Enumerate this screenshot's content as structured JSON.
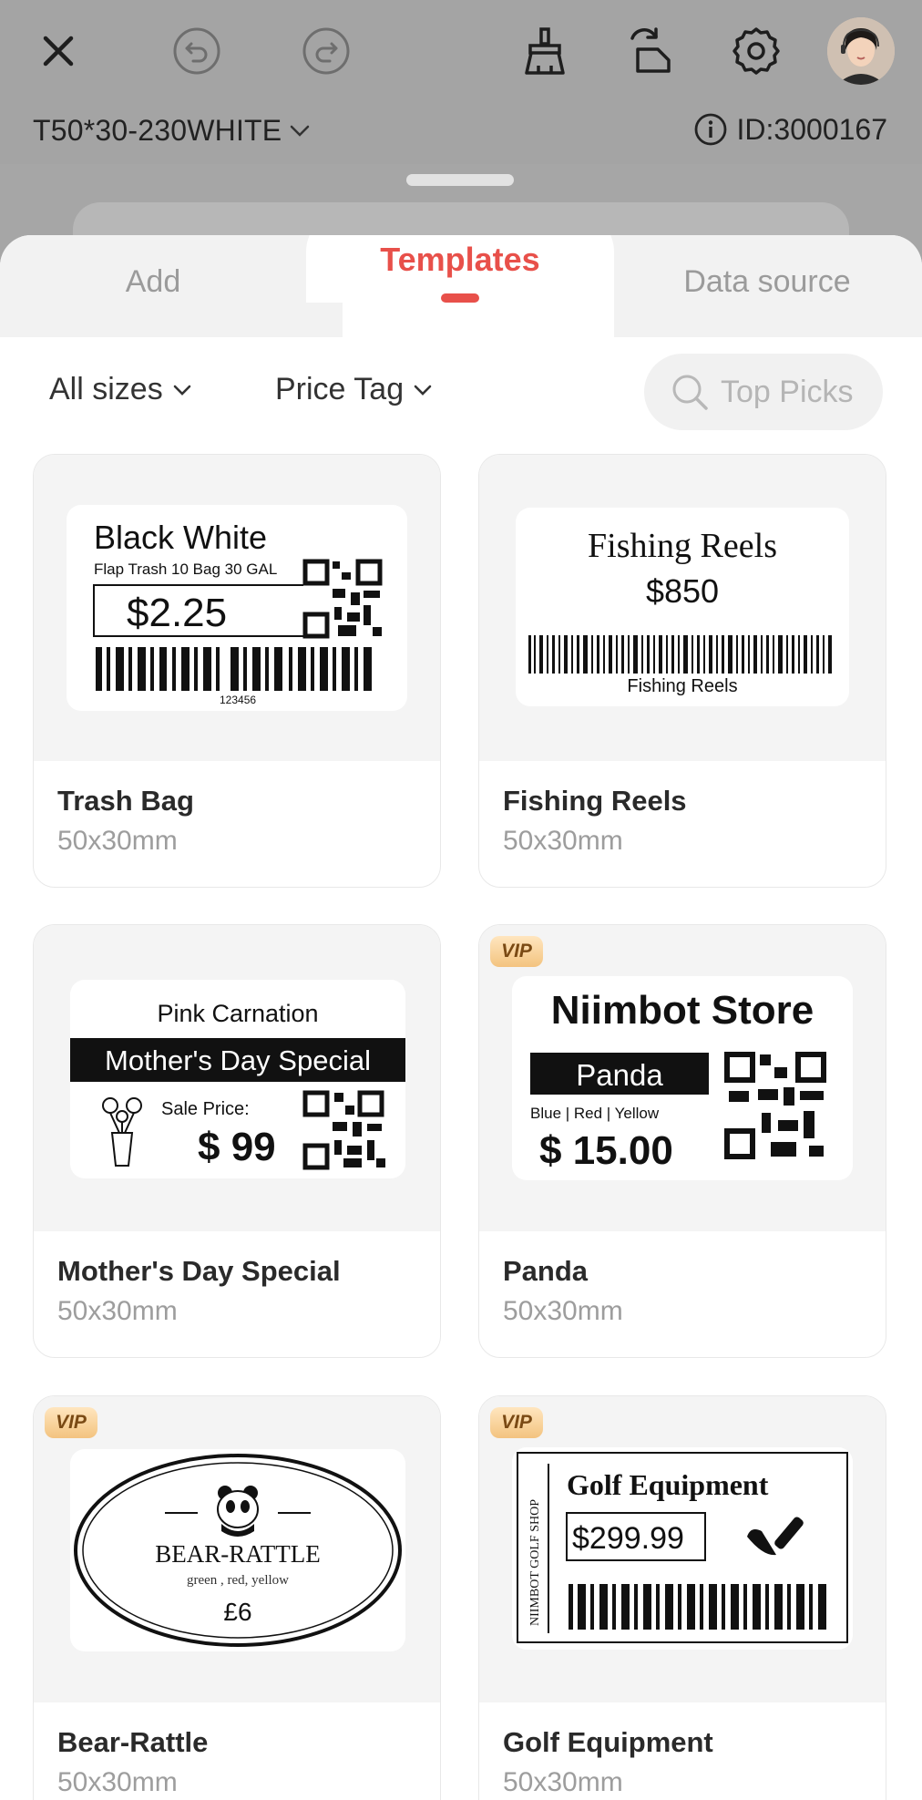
{
  "toolbar": {
    "close_icon": "close-icon",
    "undo_icon": "undo-icon",
    "redo_icon": "redo-icon",
    "clear_icon": "brush-icon",
    "rotate_icon": "rotate-icon",
    "settings_icon": "gear-icon"
  },
  "printer": {
    "label_name": "T50*30-230WHITE",
    "id_text": "ID:3000167"
  },
  "tabs": [
    {
      "label": "Add"
    },
    {
      "label": "Templates",
      "active": true
    },
    {
      "label": "Data source"
    }
  ],
  "filters": {
    "sizes": "All sizes",
    "category": "Price Tag",
    "search_placeholder": "Top Picks"
  },
  "templates": [
    {
      "name": "Trash Bag",
      "size": "50x30mm",
      "vip": false,
      "preview": {
        "title": "Black White",
        "subtitle": "Flap Trash 10 Bag 30 GAL",
        "price": "$2.25",
        "barcode_number": "123456"
      }
    },
    {
      "name": "Fishing Reels",
      "size": "50x30mm",
      "vip": false,
      "preview": {
        "title": "Fishing Reels",
        "price": "$850",
        "barcode_caption": "Fishing Reels"
      }
    },
    {
      "name": "Mother's Day Special",
      "size": "50x30mm",
      "vip": false,
      "preview": {
        "title": "Pink Carnation",
        "banner": "Mother's Day Special",
        "sale_label": "Sale Price:",
        "price": "$ 99"
      }
    },
    {
      "name": "Panda",
      "size": "50x30mm",
      "vip": true,
      "vip_label": "VIP",
      "preview": {
        "store": "Niimbot Store",
        "product": "Panda",
        "variants": "Blue  |  Red  |  Yellow",
        "price": "$ 15.00"
      }
    },
    {
      "name": "Bear-Rattle",
      "size": "50x30mm",
      "vip": true,
      "vip_label": "VIP",
      "preview": {
        "title": "BEAR-RATTLE",
        "colors": "green , red, yellow",
        "price": "£6"
      }
    },
    {
      "name": "Golf Equipment",
      "size": "50x30mm",
      "vip": true,
      "vip_label": "VIP",
      "preview": {
        "title": "Golf Equipment",
        "price": "$299.99",
        "side_text": "NIIMBOT GOLF SHOP"
      }
    }
  ]
}
